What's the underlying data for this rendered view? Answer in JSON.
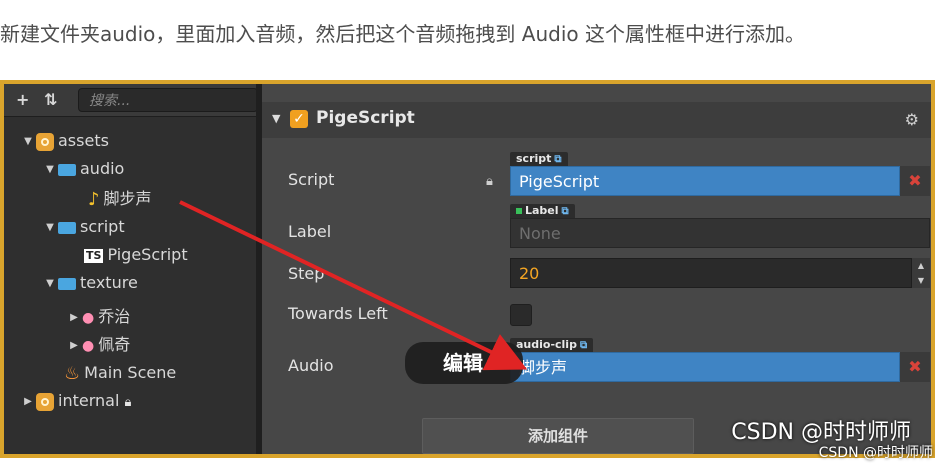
{
  "caption": "新建文件夹audio，里面加入音频，然后把这个音频拖拽到 Audio 这个属性框中进行添加。",
  "assets_panel": {
    "add_icon": "+",
    "sort_icon": "⇅",
    "search_placeholder": "搜索...",
    "tree": {
      "assets": "assets",
      "audio": "audio",
      "sound": "脚步声",
      "script": "script",
      "pigescript": "PigeScript",
      "texture": "texture",
      "qiaozhi": "乔治",
      "peiqi": "佩奇",
      "main_scene": "Main Scene",
      "internal": "internal"
    }
  },
  "inspector": {
    "component_title": "PigeScript",
    "props": {
      "script_label": "Script",
      "script_tag": "script",
      "script_value": "PigeScript",
      "label_label": "Label",
      "label_tag": "Label",
      "label_value": "None",
      "step_label": "Step",
      "step_value": "20",
      "towards_left_label": "Towards Left",
      "audio_label": "Audio",
      "audio_tag": "audio-clip",
      "audio_value": "脚步声"
    },
    "add_component_label": "添加组件"
  },
  "overlay": {
    "edit_label": "编辑",
    "watermark_large": "CSDN @时时师师",
    "watermark_small": "CSDN @时时师师"
  },
  "colors": {
    "accent_orange": "#f0a020",
    "field_blue": "#3f84c4",
    "arrow_red": "#e02424",
    "frame_gold": "#d9a42c"
  }
}
